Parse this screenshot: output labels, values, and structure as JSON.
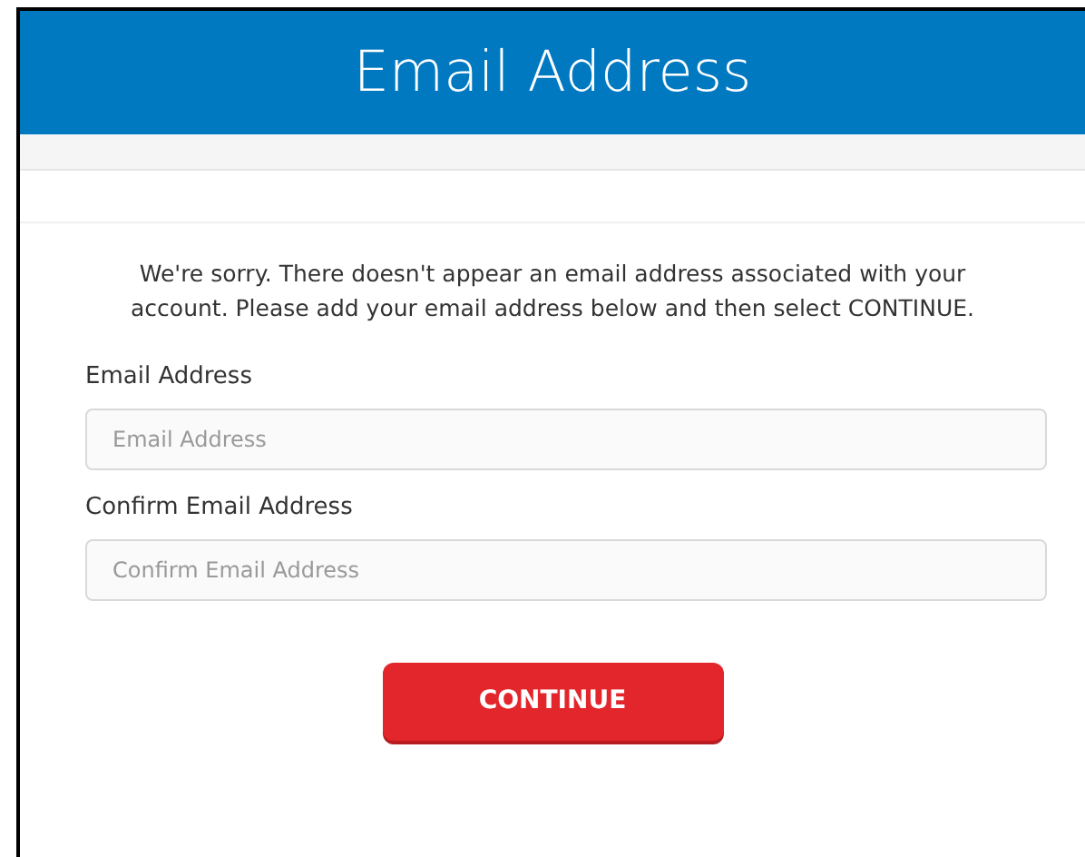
{
  "header": {
    "title": "Email Address"
  },
  "message": "We're sorry. There doesn't appear an email address associated with your account. Please add your email address below and then select CONTINUE.",
  "fields": [
    {
      "label": "Email Address",
      "placeholder": "Email Address"
    },
    {
      "label": "Confirm Email Address",
      "placeholder": "Confirm Email Address"
    }
  ],
  "button": "CONTINUE"
}
